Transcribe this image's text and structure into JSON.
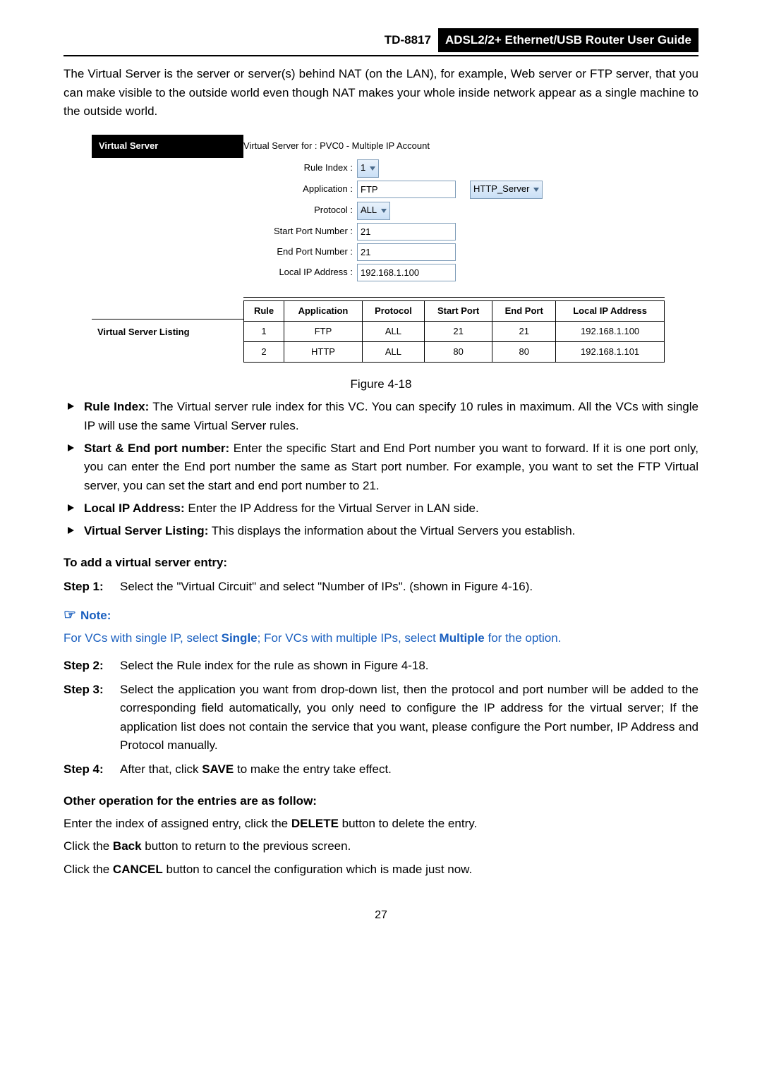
{
  "header": {
    "model": "TD-8817",
    "title": "ADSL2/2+ Ethernet/USB Router User Guide"
  },
  "intro": "The Virtual Server is the server or server(s) behind NAT (on the LAN), for example, Web server or FTP server, that you can make visible to the outside world even though NAT makes your whole inside network appear as a single machine to the outside world.",
  "ui": {
    "title": "Virtual Server",
    "caption": "Virtual Server for : PVC0 - Multiple IP Account",
    "rule_index_label": "Rule Index :",
    "rule_index_value": "1",
    "application_label": "Application :",
    "application_value": "FTP",
    "application_preset": "HTTP_Server",
    "protocol_label": "Protocol :",
    "protocol_value": "ALL",
    "start_port_label": "Start Port Number :",
    "start_port_value": "21",
    "end_port_label": "End Port Number :",
    "end_port_value": "21",
    "local_ip_label": "Local IP Address :",
    "local_ip_value": "192.168.1.100",
    "listing_title": "Virtual Server Listing",
    "table": {
      "headers": [
        "Rule",
        "Application",
        "Protocol",
        "Start Port",
        "End Port",
        "Local IP Address"
      ],
      "rows": [
        [
          "1",
          "FTP",
          "ALL",
          "21",
          "21",
          "192.168.1.100"
        ],
        [
          "2",
          "HTTP",
          "ALL",
          "80",
          "80",
          "192.168.1.101"
        ]
      ]
    }
  },
  "figure_caption": "Figure 4-18",
  "bullets": [
    {
      "lead": "Rule Index:",
      "rest": " The Virtual server rule index for this VC. You can specify 10 rules in maximum. All the VCs with single IP will use the same Virtual Server rules."
    },
    {
      "lead": "Start & End port number:",
      "rest": " Enter the specific Start and End Port number you want to forward. If it is one port only, you can enter the End port number the same as Start port number. For example, you want to set the FTP Virtual server, you can set the start and end port number to 21."
    },
    {
      "lead": "Local IP Address:",
      "rest": " Enter the IP Address for the Virtual Server in LAN side."
    },
    {
      "lead": "Virtual Server Listing:",
      "rest": " This displays the information about the Virtual Servers you establish."
    }
  ],
  "add_entry_title": "To add a virtual server entry:",
  "step1_label": "Step 1:",
  "step1_body": "Select the \"Virtual Circuit\" and select \"Number of IPs\". (shown in Figure 4-16).",
  "note_label": "Note:",
  "note_body_pre": "For VCs with single IP, select ",
  "note_body_single": "Single",
  "note_body_mid": "; For VCs with multiple IPs, select ",
  "note_body_multiple": "Multiple",
  "note_body_post": " for the option.",
  "step2_label": "Step 2:",
  "step2_body": "Select the Rule index for the rule as shown in Figure 4-18.",
  "step3_label": "Step 3:",
  "step3_body": "Select the application you want from drop-down list, then the protocol and port number will be added to the corresponding field automatically, you only need to configure the IP address for the virtual server; If the application list does not contain the service that you want, please configure the Port number, IP Address and Protocol manually.",
  "step4_label": "Step 4:",
  "step4_body_pre": "After that, click ",
  "step4_body_bold": "SAVE",
  "step4_body_post": " to make the entry take effect.",
  "other_title": "Other operation for the entries are as follow:",
  "other_lines": {
    "l1_pre": "Enter the index of assigned entry, click the ",
    "l1_bold": "DELETE",
    "l1_post": " button to delete the entry.",
    "l2_pre": "Click the ",
    "l2_bold": "Back",
    "l2_post": " button to return to the previous screen.",
    "l3_pre": "Click the ",
    "l3_bold": "CANCEL",
    "l3_post": " button to cancel the configuration which is made just now."
  },
  "page_number": "27"
}
